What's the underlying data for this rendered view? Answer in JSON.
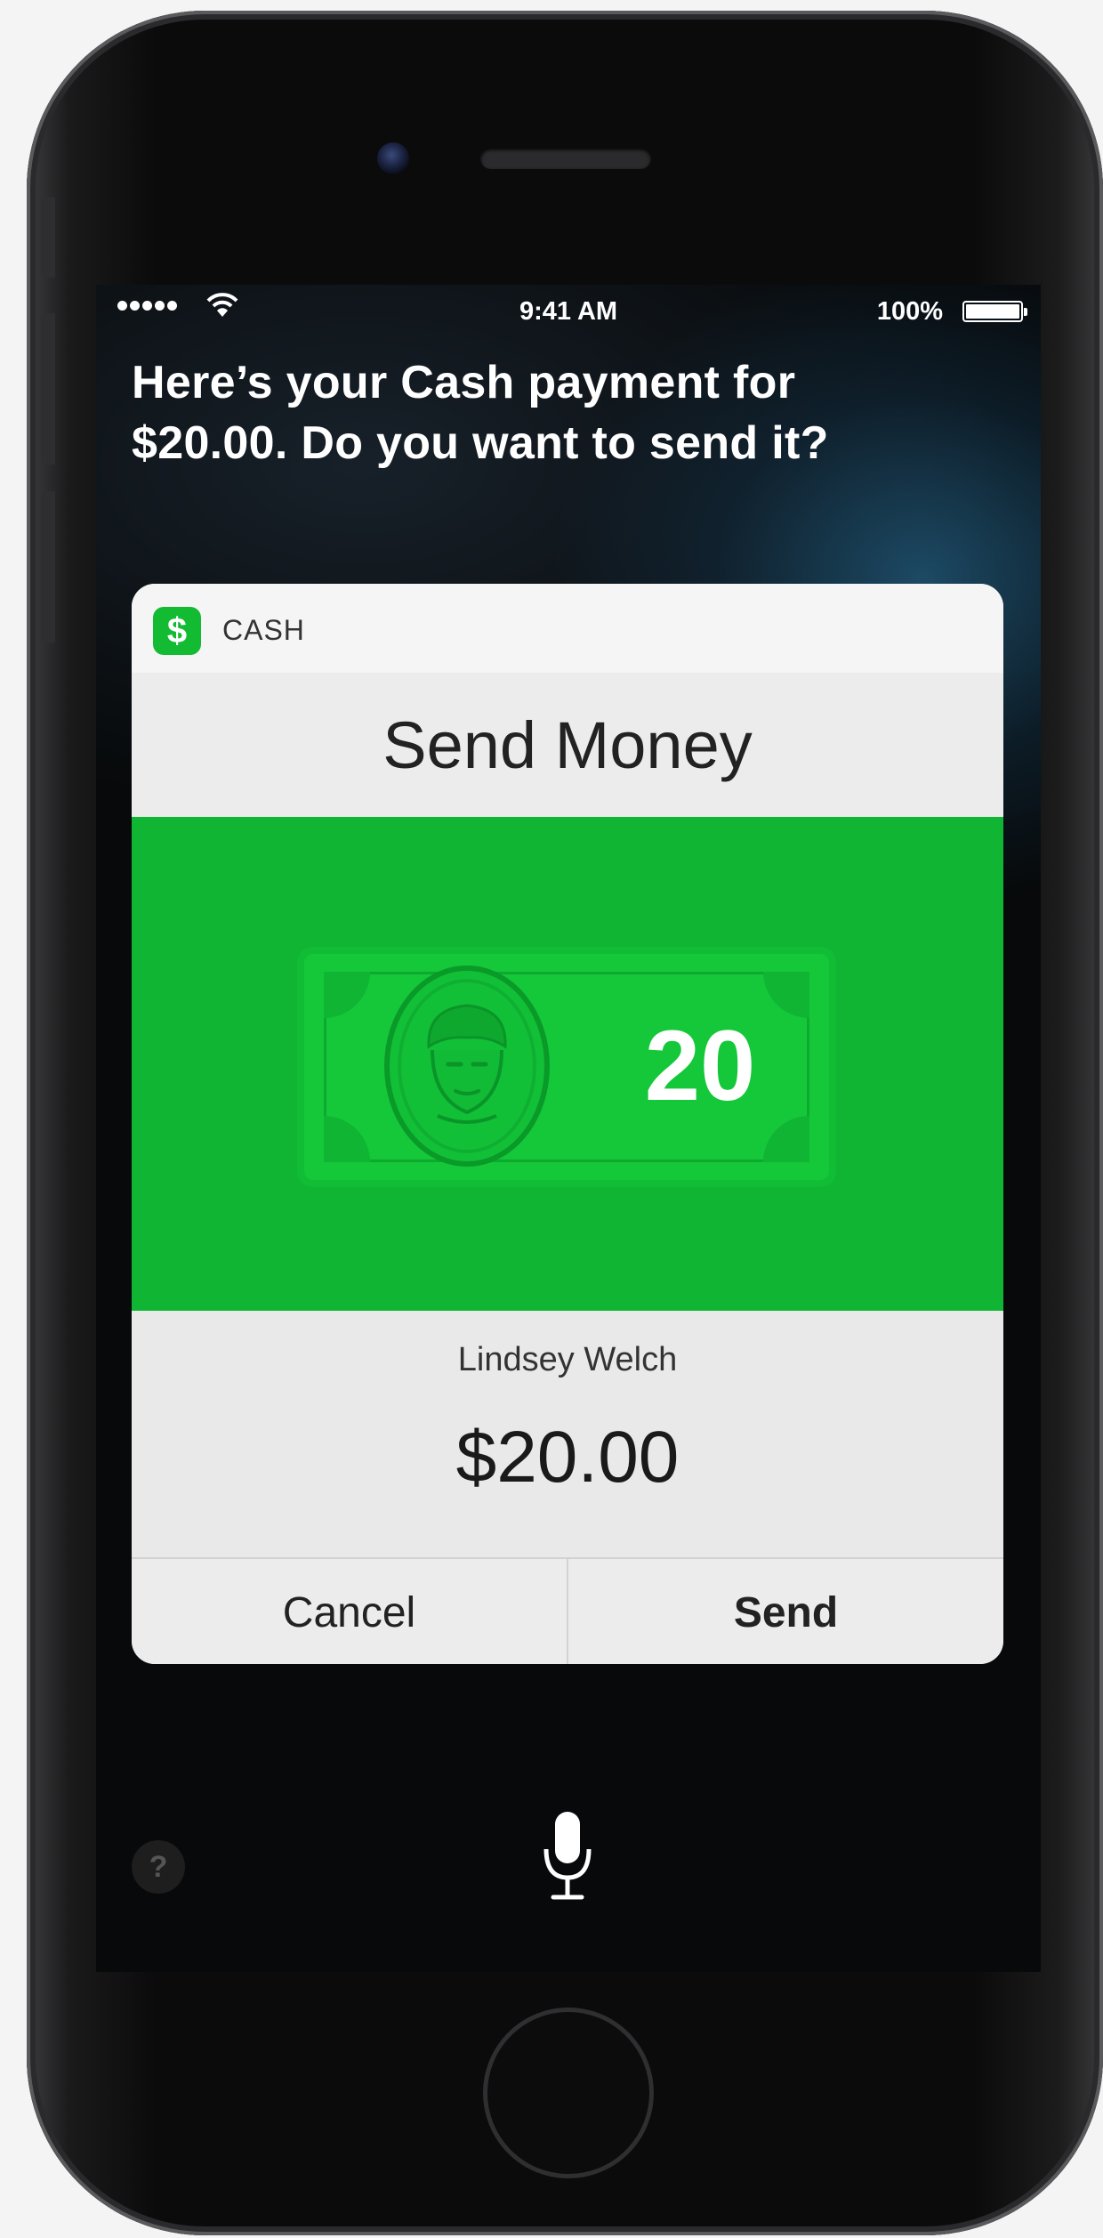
{
  "status_bar": {
    "time": "9:41 AM",
    "battery_percent": "100%",
    "signal_bars": 5,
    "icons": [
      "signal-dots-icon",
      "wifi-icon",
      "battery-icon"
    ]
  },
  "siri": {
    "response_text": "Here’s your Cash payment for $20.00. Do you want to send it?"
  },
  "card": {
    "app_name": "CASH",
    "app_icon": "dollar-sign-icon",
    "title": "Send Money",
    "bill_amount": "20",
    "bill_icon": "dollar-bill-portrait-icon",
    "recipient_name": "Lindsey Welch",
    "amount": "$20.00",
    "cancel_label": "Cancel",
    "send_label": "Send"
  },
  "bottom": {
    "help_icon": "question-mark-icon",
    "help_glyph": "?",
    "mic_icon": "microphone-icon"
  },
  "colors": {
    "cash_green": "#10b533",
    "bill_green": "#14c83a"
  }
}
